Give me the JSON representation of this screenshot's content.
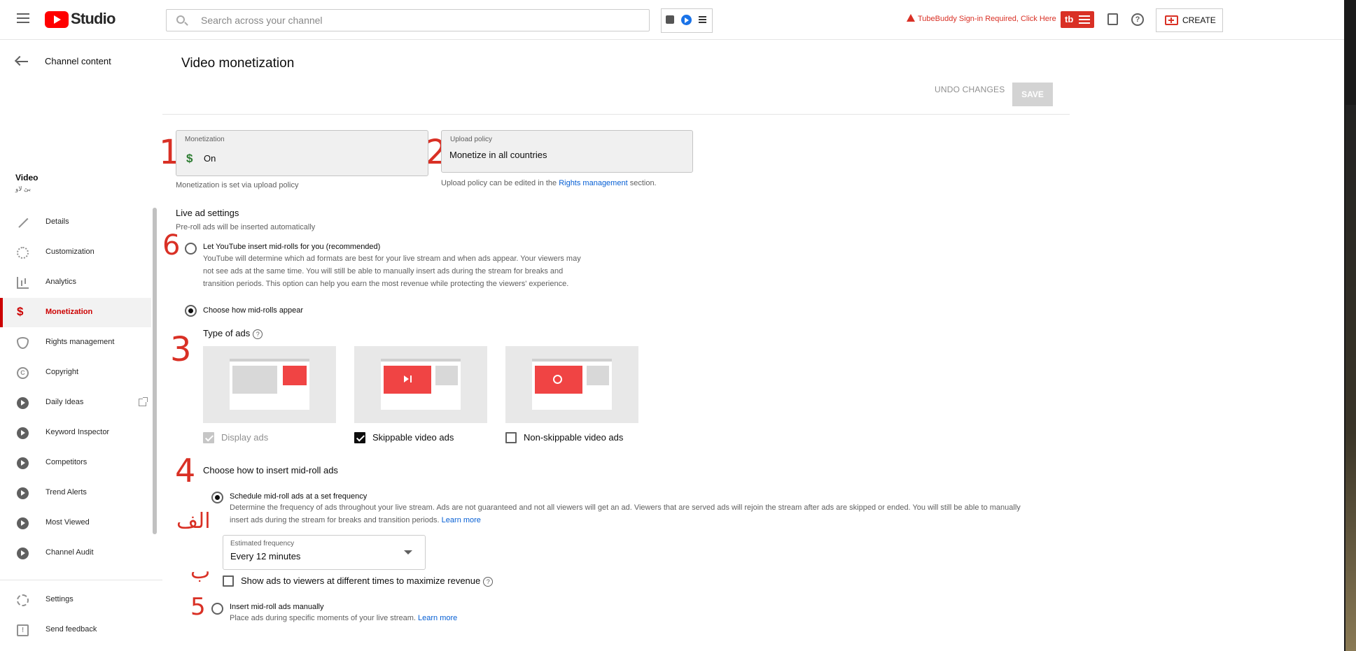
{
  "topbar": {
    "app_name": "Studio",
    "search_placeholder": "Search across your channel",
    "tubebuddy_alert": "TubeBuddy Sign-in Required, Click Here",
    "tubebuddy_logo": "tb",
    "create_label": "CREATE"
  },
  "sidebar": {
    "back_label": "Channel content",
    "video_title": "Video",
    "video_subtitle": "بێ لاو",
    "items": [
      {
        "label": "Details",
        "icon": "pencil-icon"
      },
      {
        "label": "Customization",
        "icon": "broadcast-icon"
      },
      {
        "label": "Analytics",
        "icon": "analytics-icon"
      },
      {
        "label": "Monetization",
        "icon": "dollar-icon",
        "active": true
      },
      {
        "label": "Rights management",
        "icon": "shield-icon"
      },
      {
        "label": "Copyright",
        "icon": "copyright-icon"
      },
      {
        "label": "Daily Ideas",
        "icon": "tubebuddy-icon"
      },
      {
        "label": "Keyword Inspector",
        "icon": "tubebuddy-icon"
      },
      {
        "label": "Competitors",
        "icon": "tubebuddy-icon"
      },
      {
        "label": "Trend Alerts",
        "icon": "tubebuddy-icon"
      },
      {
        "label": "Most Viewed",
        "icon": "tubebuddy-icon"
      },
      {
        "label": "Channel Audit",
        "icon": "tubebuddy-icon"
      }
    ],
    "settings_label": "Settings",
    "feedback_label": "Send feedback"
  },
  "main": {
    "page_title": "Video monetization",
    "undo_label": "UNDO CHANGES",
    "save_label": "SAVE",
    "monetization": {
      "label": "Monetization",
      "value": "On",
      "note": "Monetization is set via upload policy"
    },
    "upload_policy": {
      "label": "Upload policy",
      "value": "Monetize in all countries",
      "note_prefix": "Upload policy can be edited in the",
      "note_link": "Rights management",
      "note_suffix": "section."
    },
    "live_ad": {
      "title": "Live ad settings",
      "subtitle": "Pre-roll ads will be inserted automatically"
    },
    "option_auto": {
      "label": "Let YouTube insert mid-rolls for you (recommended)",
      "desc1": "YouTube will determine which ad formats are best for your live stream and when ads appear. Your viewers may",
      "desc2": "not see ads at the same time. You will still be able to manually insert ads during the stream for breaks and",
      "desc3": "transition periods. This option can help you earn the most revenue while protecting the viewers' experience."
    },
    "option_choose": {
      "label": "Choose how mid-rolls appear"
    },
    "type_of_ads": {
      "title": "Type of ads",
      "display": "Display ads",
      "skippable": "Skippable video ads",
      "nonskippable": "Non-skippable video ads"
    },
    "insert": {
      "title": "Choose how to insert mid-roll ads",
      "schedule_label": "Schedule mid-roll ads at a set frequency",
      "schedule_desc1": "Determine the frequency of ads throughout your live stream. Ads are not guaranteed and not all viewers will get an ad. Viewers that are served ads will rejoin the stream after ads are skipped or ended. You will still be able to manually",
      "schedule_desc2": "insert ads during the stream for breaks and transition periods.",
      "learn_more": "Learn more",
      "freq_label": "Estimated frequency",
      "freq_value": "Every 12 minutes",
      "stagger_label": "Show ads to viewers at different times to maximize revenue",
      "manual_label": "Insert mid-roll ads manually",
      "manual_desc": "Place ads during specific moments of your live stream."
    },
    "annotations": {
      "a1": "1",
      "a2": "2",
      "a3": "3",
      "a4": "4",
      "a5": "5",
      "a6": "6",
      "alef": "الف",
      "be": "ب"
    }
  },
  "colors": {
    "accent_red": "#cc0000",
    "link_blue": "#065fd4",
    "annotation_red": "#d93025"
  }
}
